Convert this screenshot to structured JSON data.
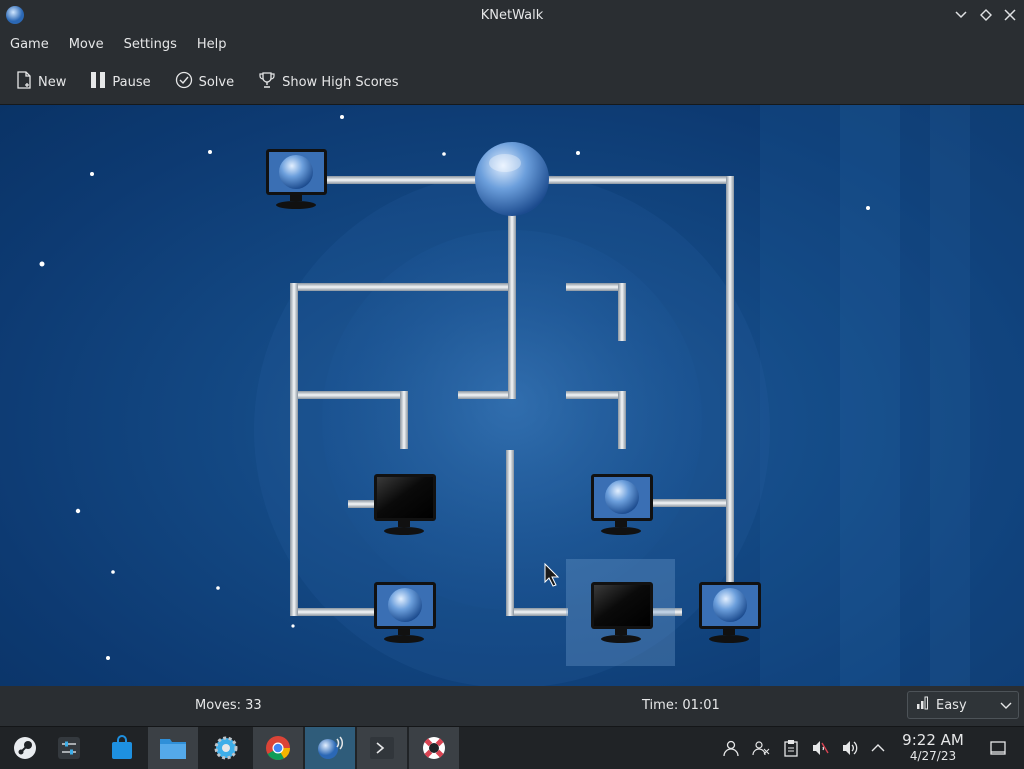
{
  "window": {
    "title": "KNetWalk",
    "app_icon": "globe-icon",
    "controls": [
      "chevron-down-icon",
      "diamond-icon",
      "close-icon"
    ]
  },
  "menu": {
    "items": [
      "Game",
      "Move",
      "Settings",
      "Help"
    ]
  },
  "toolbar": {
    "new_label": "New",
    "pause_label": "Pause",
    "solve_label": "Solve",
    "highscores_label": "Show High Scores",
    "icons": [
      "new-document-icon",
      "pause-icon",
      "check-circle-icon",
      "trophy-icon"
    ]
  },
  "status": {
    "moves": "Moves: 33",
    "time": "Time: 01:01"
  },
  "difficulty": {
    "selected": "Easy",
    "icon": "signal-bars-icon"
  },
  "taskbar": {
    "apps": [
      "steam-icon",
      "mixer-icon",
      "store-icon",
      "file-manager-icon",
      "settings-icon",
      "chrome-icon",
      "knetwalk-icon",
      "terminal-icon",
      "lifebuoy-icon"
    ],
    "tray": [
      "user-icon",
      "users-icon",
      "clipboard-icon",
      "volume-muted-icon",
      "volume-icon",
      "chevron-up-icon",
      "show-desktop-icon"
    ],
    "clock_time": "9:22 AM",
    "clock_date": "4/27/23"
  },
  "colors": {
    "background": "#0d3a72",
    "pipe": "#d8dce0",
    "chrome": "#2a2e32",
    "accent": "#3daee9"
  }
}
